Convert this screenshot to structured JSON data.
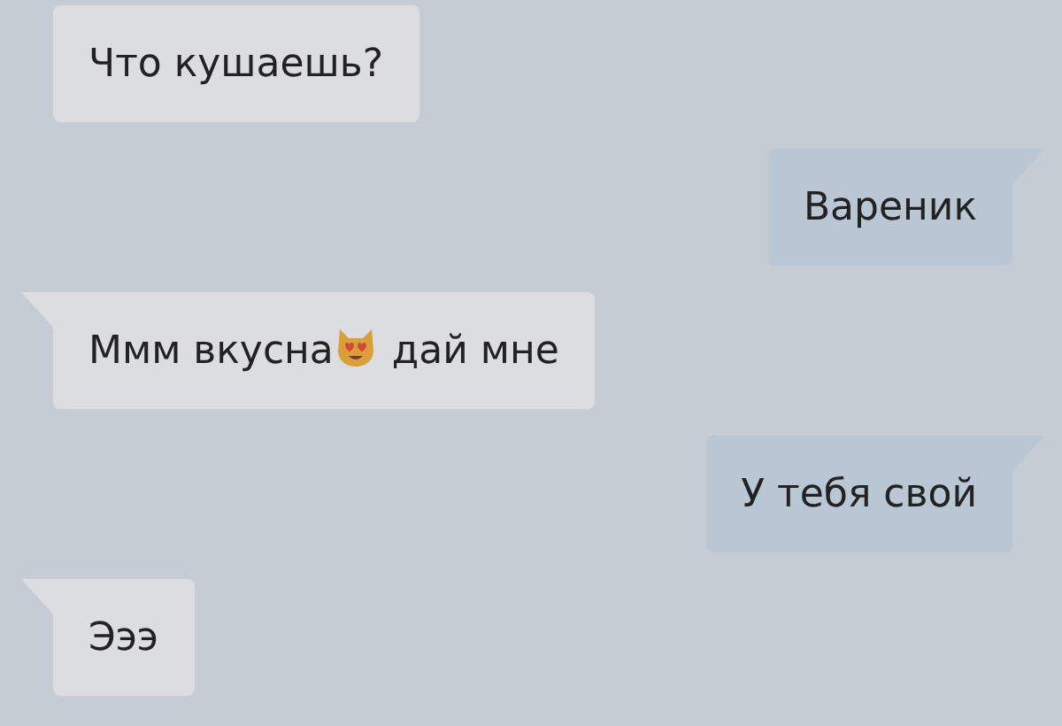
{
  "messages": [
    {
      "kind": "incoming",
      "text": "Что кушаешь?",
      "tail": false
    },
    {
      "kind": "outgoing",
      "text": "Вареник",
      "tail": true
    },
    {
      "kind": "incoming",
      "text": "Ммм вкусна",
      "sticker": true,
      "text_after": "дай мне",
      "tail": true
    },
    {
      "kind": "outgoing",
      "text": "У тебя свой",
      "tail": true
    },
    {
      "kind": "incoming",
      "text": "Эээ",
      "tail": true
    }
  ]
}
